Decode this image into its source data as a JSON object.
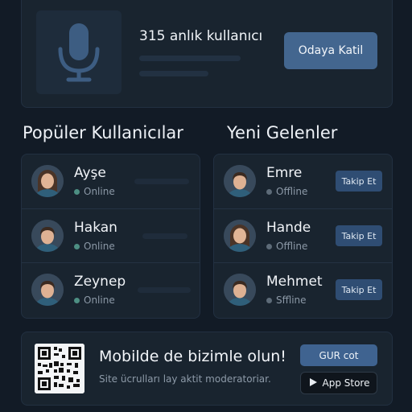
{
  "room": {
    "icon": "microphone-icon",
    "count_text": "315 anlık kullanıcı",
    "join_label": "Odaya Katil"
  },
  "popular": {
    "title": "Popüler Kullanicılar",
    "users": [
      {
        "name": "Ayşe",
        "status": "Online",
        "avatar": "female"
      },
      {
        "name": "Hakan",
        "status": "Online",
        "avatar": "male"
      },
      {
        "name": "Zeynep",
        "status": "Online",
        "avatar": "male"
      }
    ]
  },
  "newcomers": {
    "title": "Yeni Gelenler",
    "follow_label": "Takip Et",
    "users": [
      {
        "name": "Emre",
        "status": "Offline",
        "avatar": "male"
      },
      {
        "name": "Hande",
        "status": "Offline",
        "avatar": "female"
      },
      {
        "name": "Mehmet",
        "status": "Sffline",
        "avatar": "male"
      }
    ]
  },
  "promo": {
    "title": "Mobilde de bizimle olun!",
    "subtitle": "Site ücrulları lay aktit moderatoriar.",
    "primary_label": "GUR cot",
    "store_label": "App Store",
    "store_icon": "play-icon"
  },
  "colors": {
    "background": "#121b26",
    "card": "#19242f",
    "accent": "#43668f",
    "online_dot": "#4d8f83"
  }
}
